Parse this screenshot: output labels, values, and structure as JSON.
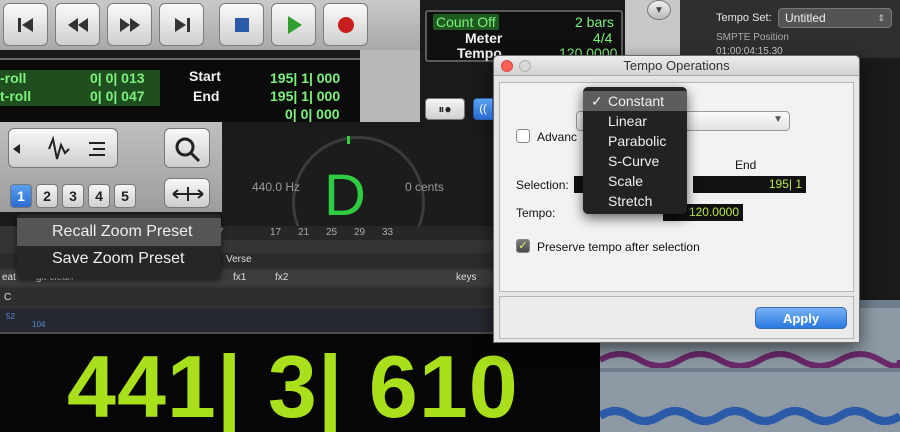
{
  "transport": {
    "buttons": [
      {
        "name": "return-to-zero-button",
        "icon": "return-to-zero-icon"
      },
      {
        "name": "rewind-button",
        "icon": "rewind-icon"
      },
      {
        "name": "fast-forward-button",
        "icon": "fast-forward-icon"
      },
      {
        "name": "go-to-end-button",
        "icon": "go-to-end-icon"
      },
      {
        "name": "stop-button",
        "icon": "stop-icon"
      },
      {
        "name": "play-button",
        "icon": "play-icon"
      },
      {
        "name": "record-button",
        "icon": "record-icon"
      }
    ]
  },
  "counters": {
    "preroll_label": "-roll",
    "preroll_value": "0| 0| 013",
    "postroll_label": "t-roll",
    "postroll_value": "0| 0| 047",
    "start_label": "Start",
    "start_value": "195| 1| 000",
    "end_label": "End",
    "end_value": "195| 1| 000",
    "length_value": "0| 0| 000"
  },
  "meter_box": {
    "count_off_label": "Count Off",
    "count_off_value": "2 bars",
    "meter_label": "Meter",
    "meter_value": "4/4",
    "tempo_label": "Tempo",
    "tempo_value": "120.0000"
  },
  "right_panel": {
    "tempo_set_label": "Tempo Set:",
    "tempo_set_value": "Untitled",
    "smpte_label": "SMPTE Position",
    "smpte_value": "01:00:04:15.30"
  },
  "zoom_presets": [
    "1",
    "2",
    "3",
    "4",
    "5"
  ],
  "tuner": {
    "freq": "440.0 Hz",
    "note": "D",
    "cents": "0 cents"
  },
  "context_menu": {
    "items": [
      "Recall Zoom Preset",
      "Save Zoom Preset"
    ]
  },
  "timeline": {
    "ruler_ticks": [
      "7",
      "17",
      "21",
      "25",
      "29",
      "33"
    ],
    "marker_label": "Verse",
    "track_labels": [
      "eat",
      "git clean",
      "fx1",
      "fx2",
      "keys"
    ],
    "row_c_label": "C",
    "row_nums": [
      "52",
      "104"
    ]
  },
  "big_counter": "441| 3| 610",
  "dialog": {
    "title": "Tempo Operations",
    "advanced_label": "Advanc",
    "end_header": "End",
    "selection_label": "Selection:",
    "selection_end": "195| 1",
    "tempo_label": "Tempo:",
    "tempo_value": "120.0000",
    "preserve_label": "Preserve tempo after selection",
    "apply_label": "Apply",
    "check_mark": "✓"
  },
  "curve_menu": {
    "items": [
      "Constant",
      "Linear",
      "Parabolic",
      "S-Curve",
      "Scale",
      "Stretch"
    ],
    "selected_index": 0,
    "check_mark": "✓"
  },
  "colors": {
    "counter_green": "#7df07d",
    "big_counter_lime": "#a9df1b",
    "tuner_note_green": "#2ecc40",
    "apply_blue": "#2a78e0"
  }
}
